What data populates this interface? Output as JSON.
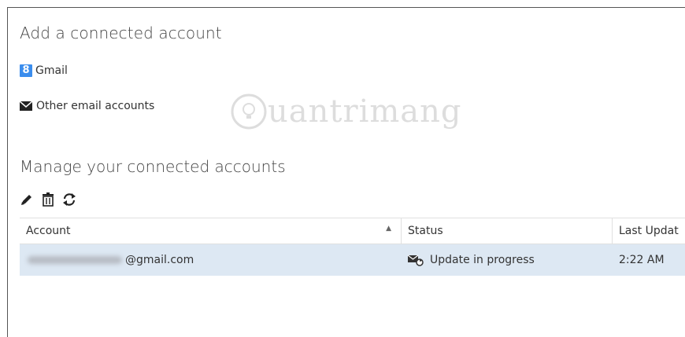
{
  "add_section": {
    "title": "Add a connected account",
    "gmail_badge": "8",
    "gmail_label": "Gmail",
    "other_label": "Other email accounts"
  },
  "watermark": {
    "text": "uantrimang"
  },
  "manage_section": {
    "title": "Manage your connected accounts",
    "toolbar": [
      "edit-icon",
      "delete-icon",
      "refresh-icon"
    ]
  },
  "table": {
    "headers": {
      "account": "Account",
      "status": "Status",
      "updated": "Last Updat"
    },
    "rows": [
      {
        "account": "@gmail.com",
        "status": "Update in progress",
        "updated": "2:22 AM"
      }
    ]
  },
  "colors": {
    "gmail_blue": "#3b8ded",
    "row_selected": "#dde8f3"
  }
}
